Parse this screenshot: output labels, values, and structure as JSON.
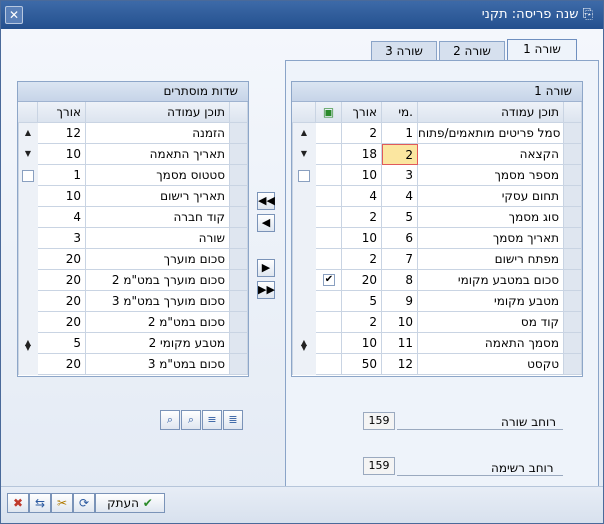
{
  "window": {
    "title": "שנה פריסה: תקני",
    "close_label": "✕"
  },
  "tabs": [
    {
      "label": "שורה 1",
      "active": true
    },
    {
      "label": "שורה 2",
      "active": false
    },
    {
      "label": "שורה 3",
      "active": false
    }
  ],
  "row_grid": {
    "title": "שורה 1",
    "headers": {
      "content": "תוכן עמודה",
      "pos": "מי.",
      "length": "אורך"
    },
    "rows": [
      {
        "content": "סמל פריטים מותאמים/פתוח",
        "pos": "1",
        "length": "2",
        "checked": false
      },
      {
        "content": "הקצאה",
        "pos": "2",
        "length": "18",
        "checked": false
      },
      {
        "content": "מספר מסמך",
        "pos": "3",
        "length": "10",
        "checked": false
      },
      {
        "content": "תחום עסקי",
        "pos": "4",
        "length": "4",
        "checked": false
      },
      {
        "content": "סוג מסמך",
        "pos": "5",
        "length": "2",
        "checked": false
      },
      {
        "content": "תאריך מסמך",
        "pos": "6",
        "length": "10",
        "checked": false
      },
      {
        "content": "מפתח רישום",
        "pos": "7",
        "length": "2",
        "checked": false
      },
      {
        "content": "סכום במטבע מקומי",
        "pos": "8",
        "length": "20",
        "checked": true
      },
      {
        "content": "מטבע מקומי",
        "pos": "9",
        "length": "5",
        "checked": false
      },
      {
        "content": "קוד מס",
        "pos": "10",
        "length": "2",
        "checked": false
      },
      {
        "content": "מסמך התאמה",
        "pos": "11",
        "length": "10",
        "checked": false
      },
      {
        "content": "טקסט",
        "pos": "12",
        "length": "50",
        "checked": false
      }
    ]
  },
  "hidden_grid": {
    "title": "שדות מוסתרים",
    "headers": {
      "content": "תוכן עמודה",
      "length": "אורך"
    },
    "rows": [
      {
        "content": "הזמנה",
        "length": "12"
      },
      {
        "content": "תאריך התאמה",
        "length": "10"
      },
      {
        "content": "סטטוס מסמך",
        "length": "1"
      },
      {
        "content": "תאריך רישום",
        "length": "10"
      },
      {
        "content": "קוד חברה",
        "length": "4"
      },
      {
        "content": "שורה",
        "length": "3"
      },
      {
        "content": "סכום מוערך",
        "length": "20"
      },
      {
        "content": "סכום מוערך במט\"מ 2",
        "length": "20"
      },
      {
        "content": "סכום מוערך במט\"מ 3",
        "length": "20"
      },
      {
        "content": "סכום במט\"מ 2",
        "length": "20"
      },
      {
        "content": "מטבע מקומי 2",
        "length": "5"
      },
      {
        "content": "סכום במט\"מ 3",
        "length": "20"
      }
    ]
  },
  "row_width": {
    "label": "רוחב שורה",
    "value": "159"
  },
  "list_width": {
    "label": "רוחב רשימה",
    "value": "159"
  },
  "buttons": {
    "ok": "העתק"
  },
  "colors": {
    "titlebar": "#2c5a97",
    "accent": "#fbe6a0",
    "highlight_border": "#e05a5a"
  }
}
